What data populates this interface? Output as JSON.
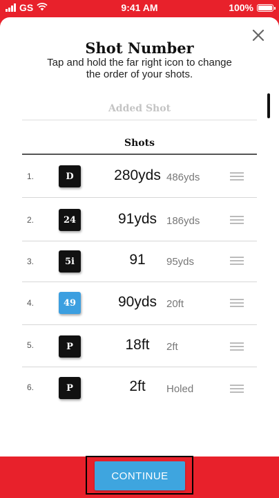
{
  "status_bar": {
    "carrier": "GS",
    "time": "9:41 AM",
    "battery": "100%"
  },
  "modal": {
    "title": "Shot Number",
    "subtitle": "Tap and hold the far right icon to change the order of your shots.",
    "added_shot_label": "Added Shot",
    "shots_header": "Shots"
  },
  "shots": [
    {
      "num": "1.",
      "club": "D",
      "distance": "280yds",
      "remaining": "486yds",
      "club_color": "#111111"
    },
    {
      "num": "2.",
      "club": "24",
      "distance": "91yds",
      "remaining": "186yds",
      "club_color": "#111111"
    },
    {
      "num": "3.",
      "club": "5i",
      "distance": "91",
      "remaining": "95yds",
      "club_color": "#111111"
    },
    {
      "num": "4.",
      "club": "49",
      "distance": "90yds",
      "remaining": "20ft",
      "club_color": "#3c9fe0"
    },
    {
      "num": "5.",
      "club": "P",
      "distance": "18ft",
      "remaining": "2ft",
      "club_color": "#111111"
    },
    {
      "num": "6.",
      "club": "P",
      "distance": "2ft",
      "remaining": "Holed",
      "club_color": "#111111"
    }
  ],
  "footer": {
    "continue_label": "CONTINUE"
  },
  "colors": {
    "brand_red": "#e8212b",
    "accent_blue": "#3ea5df"
  },
  "icons": [
    "signal-icon",
    "wifi-icon",
    "battery-icon",
    "close-icon",
    "drag-handle-icon"
  ]
}
